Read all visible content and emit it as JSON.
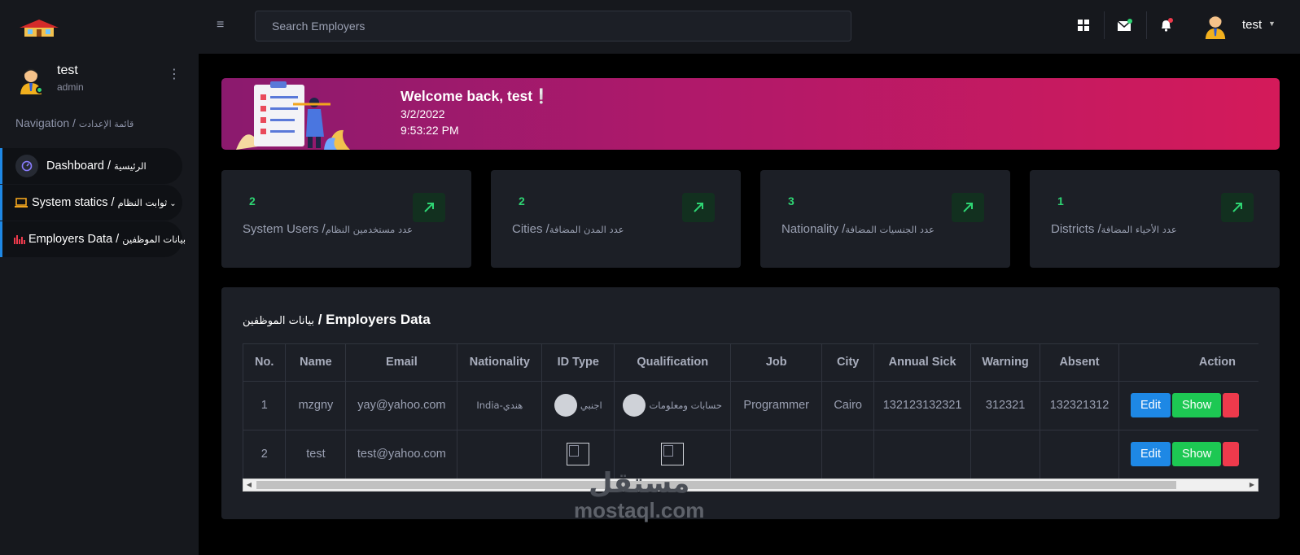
{
  "search": {
    "placeholder": "Search Employers"
  },
  "profile": {
    "name": "test",
    "role": "admin"
  },
  "nav": {
    "heading": "Navigation / ",
    "heading_ar": "قائمة الإعدادت",
    "items": [
      {
        "label": "Dashboard / ",
        "label_ar": "الرئيسية"
      },
      {
        "label": "System statics / ",
        "label_ar": "ثوابت النظام"
      },
      {
        "label": "Employers Data / ",
        "label_ar": "بيانات الموظفين"
      }
    ]
  },
  "topbar": {
    "user": "test"
  },
  "banner": {
    "welcome": "Welcome back, test❕",
    "date": "3/2/2022",
    "time": "9:53:22 PM"
  },
  "stats": [
    {
      "count": "2",
      "label": "System Users /",
      "label_ar": "عدد مستخدمين النظام"
    },
    {
      "count": "2",
      "label": "Cities /",
      "label_ar": "عدد المدن المضافة"
    },
    {
      "count": "3",
      "label": "Nationality /",
      "label_ar": "عدد الجنسيات المضافة"
    },
    {
      "count": "1",
      "label": "Districts /",
      "label_ar": "عدد الأحياء المضافة"
    }
  ],
  "table": {
    "title_ar": "بيانات الموظفين",
    "title": " / Employers Data",
    "headers": [
      "No.",
      "Name",
      "Email",
      "Nationality",
      "ID Type",
      "Qualification",
      "Job",
      "City",
      "Annual Sick",
      "Warning",
      "Absent",
      "Action"
    ],
    "rows": [
      {
        "no": "1",
        "name": "mzgny",
        "email": "yay@yahoo.com",
        "nationality": "India-هندي",
        "id_type": "اجنبي",
        "qualification": "حسابات ومعلومات",
        "job": "Programmer",
        "city": "Cairo",
        "annual_sick": "132123132321",
        "warning": "312321",
        "absent": "132321312"
      },
      {
        "no": "2",
        "name": "test",
        "email": "test@yahoo.com",
        "nationality": "",
        "id_type": "",
        "qualification": "",
        "job": "",
        "city": "",
        "annual_sick": "",
        "warning": "",
        "absent": ""
      }
    ],
    "edit_label": "Edit",
    "show_label": "Show"
  },
  "watermark": {
    "ar": "مستقل",
    "en": "mostaql.com"
  },
  "colors": {
    "accent": "#1e88e5",
    "success": "#1dc853",
    "danger": "#ee3a4c",
    "banner_start": "#8b1a6e",
    "banner_end": "#d41a5a"
  }
}
